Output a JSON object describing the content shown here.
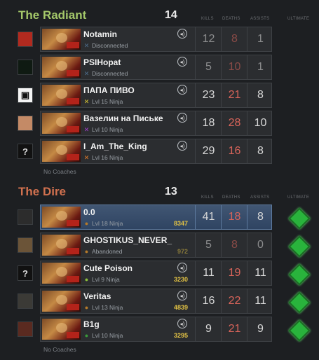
{
  "radiant": {
    "title": "The Radiant",
    "score": "14",
    "headers": {
      "kills": "KILLS",
      "deaths": "DEATHS",
      "assists": "ASSISTS",
      "ultimate": "ULTIMATE"
    },
    "players": [
      {
        "avatar": "",
        "name": "Notamin",
        "status_icon": "x-icon",
        "status": "Disconnected",
        "kills": "12",
        "deaths": "8",
        "assists": "1"
      },
      {
        "avatar": "",
        "name": "PSIHopat",
        "status_icon": "x-icon",
        "status": "Disconnected",
        "kills": "5",
        "deaths": "10",
        "assists": "1"
      },
      {
        "avatar": "",
        "name": "ПАПА ПИВО",
        "status_icon": "x-icon",
        "status": "Lvl 15 Ninja",
        "kills": "23",
        "deaths": "21",
        "assists": "8"
      },
      {
        "avatar": "",
        "name": "Вазелин на Письке",
        "status_icon": "x-icon",
        "status": "Lvl 10 Ninja",
        "kills": "18",
        "deaths": "28",
        "assists": "10"
      },
      {
        "avatar": "?",
        "name": "I_Am_The_King",
        "status_icon": "x-icon",
        "status": "Lvl 16 Ninja",
        "kills": "29",
        "deaths": "16",
        "assists": "8"
      }
    ],
    "coaches": "No Coaches"
  },
  "dire": {
    "title": "The Dire",
    "score": "13",
    "headers": {
      "kills": "KILLS",
      "deaths": "DEATHS",
      "assists": "ASSISTS",
      "ultimate": "ULTIMATE"
    },
    "players": [
      {
        "avatar": "",
        "name": "0.0",
        "status_icon": "circle-icon",
        "status": "Lvl 18 Ninja",
        "mmr": "8347",
        "kills": "41",
        "deaths": "18",
        "assists": "8"
      },
      {
        "avatar": "",
        "name": "GHOSTIKUS_NEVER_",
        "status_icon": "circle-icon",
        "status": "Abandoned",
        "mmr": "972",
        "kills": "5",
        "deaths": "8",
        "assists": "0"
      },
      {
        "avatar": "?",
        "name": "Cute Poison",
        "status_icon": "circle-icon",
        "status": "Lvl 9 Ninja",
        "mmr": "3230",
        "kills": "11",
        "deaths": "19",
        "assists": "11"
      },
      {
        "avatar": "",
        "name": "Veritas",
        "status_icon": "circle-icon",
        "status": "Lvl 13 Ninja",
        "mmr": "4839",
        "kills": "16",
        "deaths": "22",
        "assists": "11"
      },
      {
        "avatar": "",
        "name": "B1g",
        "status_icon": "circle-icon",
        "status": "Lvl 10 Ninja",
        "mmr": "3295",
        "kills": "9",
        "deaths": "21",
        "assists": "9"
      }
    ],
    "coaches": "No Coaches"
  },
  "colors": {
    "radiant_title": "#a4c86a",
    "dire_title": "#d2714f",
    "deaths": "#d9645a",
    "mmr": "#e2c244",
    "ultimate": "#29b33c",
    "highlight_row": "#415673"
  }
}
